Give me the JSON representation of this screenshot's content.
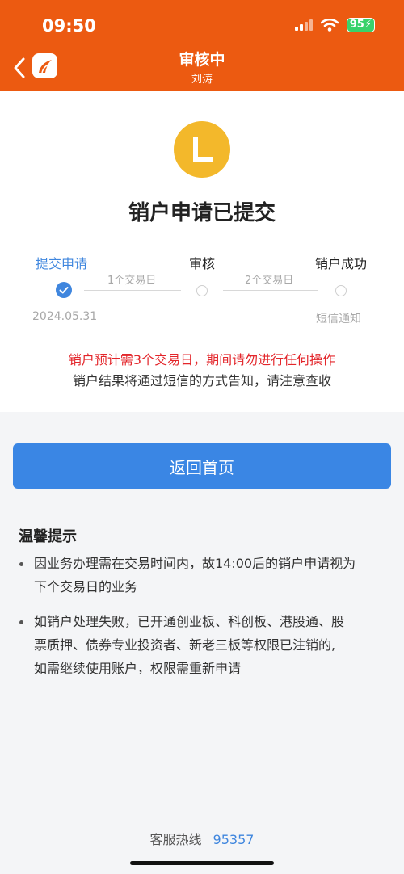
{
  "status_bar": {
    "time": "09:50",
    "battery": "95"
  },
  "header": {
    "title": "审核中",
    "subtitle": "刘涛"
  },
  "colors": {
    "brand": "#ec5a11",
    "accent": "#3f86de",
    "avatar": "#f3b82b",
    "warning": "#e3262b"
  },
  "avatar": {
    "letter": "L"
  },
  "main": {
    "title": "销户申请已提交"
  },
  "steps": [
    {
      "label": "提交申请",
      "sublabel": "2024.05.31",
      "state": "done"
    },
    {
      "label": "审核",
      "sublabel": "",
      "state": "pending"
    },
    {
      "label": "销户成功",
      "sublabel": "短信通知",
      "state": "pending"
    }
  ],
  "step_gaps": [
    "1个交易日",
    "2个交易日"
  ],
  "messages": {
    "warning": "销户预计需3个交易日，期间请勿进行任何操作",
    "note": "销户结果将通过短信的方式告知，请注意查收"
  },
  "return_button": {
    "label": "返回首页"
  },
  "tips": {
    "title": "温馨提示",
    "items": [
      {
        "line1": "因业务办理需在交易时间内，故14:00后的销户申请视为",
        "line2": "下个交易日的业务"
      },
      {
        "line1": "如销户处理失败，已开通创业板、科创板、港股通、股",
        "line2": "票质押、债券专业投资者、新老三板等权限已注销的,",
        "line3": "如需继续使用账户，权限需重新申请"
      }
    ]
  },
  "hotline": {
    "label": "客服热线",
    "number": "95357"
  }
}
